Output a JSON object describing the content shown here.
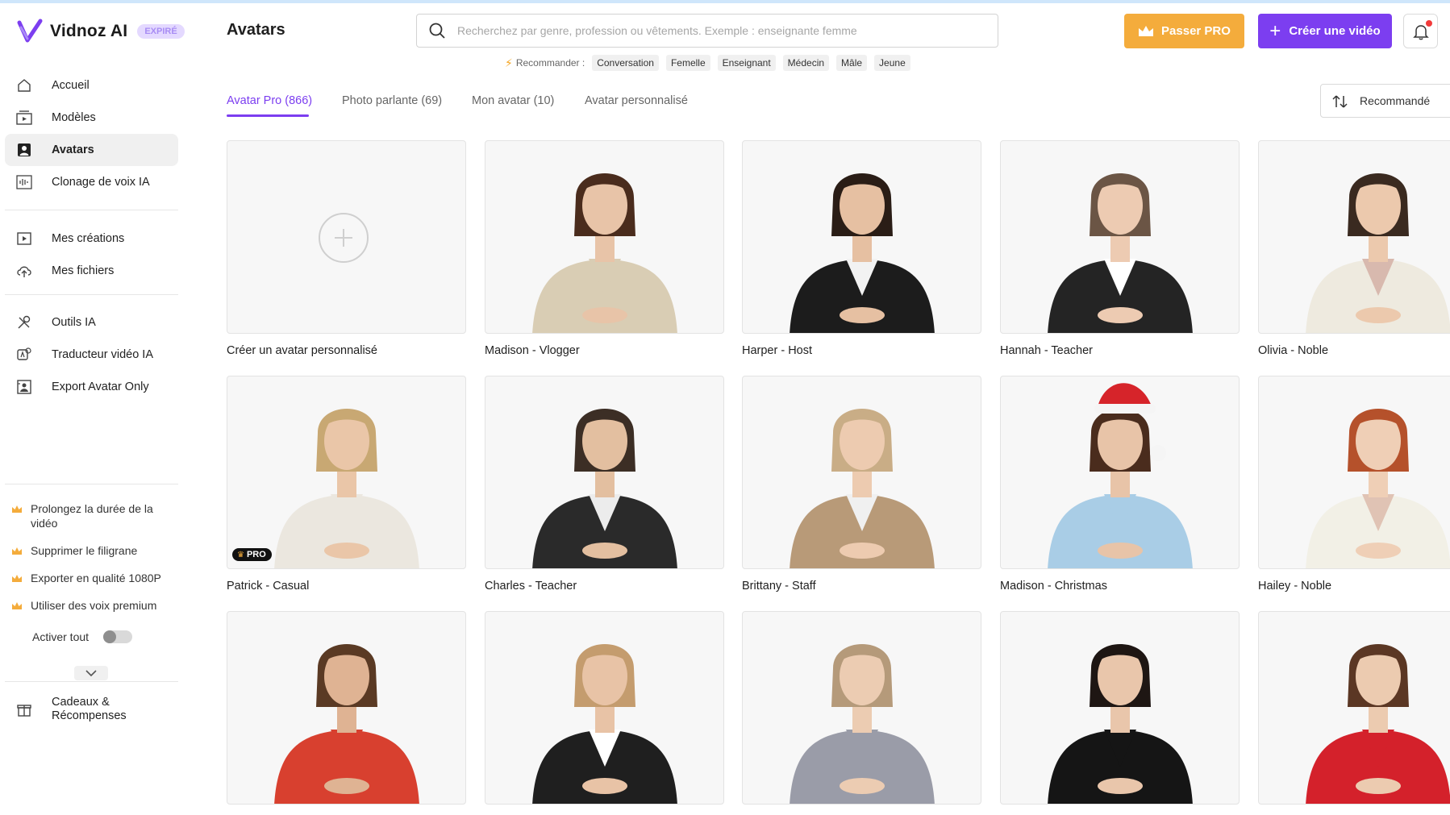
{
  "brand": {
    "name": "Vidnoz AI",
    "badge": "EXPIRÉ"
  },
  "sidebar": {
    "group1": [
      {
        "label": "Accueil",
        "icon": "home-icon"
      },
      {
        "label": "Modèles",
        "icon": "templates-icon"
      },
      {
        "label": "Avatars",
        "icon": "avatar-icon",
        "active": true
      },
      {
        "label": "Clonage de voix IA",
        "icon": "voice-wave-icon"
      }
    ],
    "group2": [
      {
        "label": "Mes créations",
        "icon": "play-square-icon"
      },
      {
        "label": "Mes fichiers",
        "icon": "upload-cloud-icon"
      }
    ],
    "group3": [
      {
        "label": "Outils IA",
        "icon": "tools-icon"
      },
      {
        "label": "Traducteur vidéo IA",
        "icon": "translate-icon"
      },
      {
        "label": "Export Avatar Only",
        "icon": "export-avatar-icon"
      }
    ],
    "perks": [
      "Prolongez la durée de la vidéo",
      "Supprimer le filigrane",
      "Exporter en qualité 1080P",
      "Utiliser des voix premium"
    ],
    "activate_all": "Activer tout",
    "gifts": "Cadeaux & Récompenses"
  },
  "header": {
    "title": "Avatars",
    "search_placeholder": "Recherchez par genre, profession ou vêtements. Exemple : enseignante femme",
    "recommend_label": "Recommander :",
    "chips": [
      "Conversation",
      "Femelle",
      "Enseignant",
      "Médecin",
      "Mâle",
      "Jeune"
    ],
    "pro_button": "Passer PRO",
    "create_button": "Créer une vidéo"
  },
  "tabs": [
    {
      "label": "Avatar Pro (866)",
      "active": true
    },
    {
      "label": "Photo parlante (69)"
    },
    {
      "label": "Mon avatar (10)"
    },
    {
      "label": "Avatar personnalisé"
    }
  ],
  "sort": {
    "label": "Recommandé"
  },
  "create_card": {
    "label": "Créer un avatar personnalisé"
  },
  "avatars": [
    {
      "name": "Madison - Vlogger",
      "skin": "#e8c4a8",
      "hair": "#4a2c1d",
      "outfit": "#d9cdb4",
      "inner": "#d9cdb4"
    },
    {
      "name": "Harper - Host",
      "skin": "#e6c0a2",
      "hair": "#2a1d16",
      "outfit": "#1c1c1c",
      "inner": "#f2f2f2"
    },
    {
      "name": "Hannah - Teacher",
      "skin": "#edcbb2",
      "hair": "#6b5545",
      "outfit": "#242424",
      "inner": "#ffffff"
    },
    {
      "name": "Olivia - Noble",
      "skin": "#ecc9ad",
      "hair": "#3a2a20",
      "outfit": "#eeeadf",
      "inner": "#d8b9ae"
    },
    {
      "name": "Patrick - Casual",
      "skin": "#eac6a8",
      "hair": "#c8a873",
      "outfit": "#ebe7df",
      "inner": "#ebe7df",
      "pro": true,
      "pro_label": "PRO"
    },
    {
      "name": "Charles - Teacher",
      "skin": "#e3bfa0",
      "hair": "#3c2e25",
      "outfit": "#2a2a2a",
      "inner": "#ececec"
    },
    {
      "name": "Brittany - Staff",
      "skin": "#edcbb0",
      "hair": "#c9ad86",
      "outfit": "#b89a78",
      "inner": "#f0f0f0"
    },
    {
      "name": "Madison - Christmas",
      "skin": "#e8c4a8",
      "hair": "#4a2c1d",
      "outfit": "#a9cde6",
      "inner": "#a9cde6",
      "hat": "#d6242a"
    },
    {
      "name": "Hailey - Noble",
      "skin": "#efcfb6",
      "hair": "#b5512b",
      "outfit": "#f2f0e6",
      "inner": "#e0c3b4"
    },
    {
      "name": "",
      "skin": "#dfb393",
      "hair": "#5a3a24",
      "outfit": "#d8402f",
      "inner": "#d8402f"
    },
    {
      "name": "",
      "skin": "#e8c3a6",
      "hair": "#c49c6e",
      "outfit": "#1f1f1f",
      "inner": "#ffffff"
    },
    {
      "name": "",
      "skin": "#ecccb2",
      "hair": "#b59a7a",
      "outfit": "#9a9ca8",
      "inner": "#9a9ca8"
    },
    {
      "name": "",
      "skin": "#e9c6ab",
      "hair": "#1e1613",
      "outfit": "#151515",
      "inner": "#151515"
    },
    {
      "name": "",
      "skin": "#eccbb0",
      "hair": "#5b3724",
      "outfit": "#d4212b",
      "inner": "#d4212b"
    }
  ],
  "colors": {
    "accent": "#7c3ef0",
    "pro": "#f4ac3c",
    "notification": "#f23a3a"
  }
}
